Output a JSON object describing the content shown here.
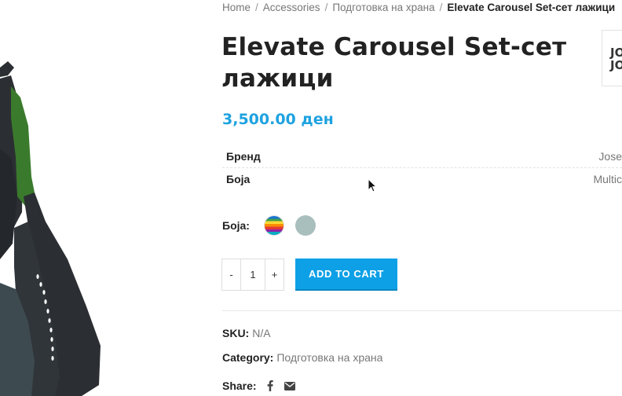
{
  "breadcrumb": {
    "items": [
      "Home",
      "Accessories",
      "Подготовка на храна"
    ],
    "current": "Elevate Carousel Set-сет лажици",
    "separator": "/"
  },
  "product": {
    "title": "Elevate Carousel Set-сет лажици",
    "price": "3,500.00 ден",
    "brand_logo_text": [
      "JO",
      "JO"
    ]
  },
  "attributes": [
    {
      "key": "Бренд",
      "value": "Jose"
    },
    {
      "key": "Боја",
      "value": "Multic"
    }
  ],
  "color_picker": {
    "label": "Боја",
    "label_suffix": ":",
    "options": [
      "multi-color",
      "sage-gray"
    ]
  },
  "quantity": {
    "minus": "-",
    "value": "1",
    "plus": "+"
  },
  "add_to_cart": "ADD TO CART",
  "meta": {
    "sku_label": "SKU:",
    "sku_value": "N/A",
    "category_label": "Category:",
    "category_value": "Подготовка на храна",
    "share_label": "Share:"
  },
  "colors": {
    "accent": "#1ea2e0",
    "button": "#0da0e6",
    "swatch_plain": "#a9bfbd",
    "handle_green": "#3a7a2c",
    "utensil_dark": "#2b2f33"
  },
  "icons": [
    "facebook-icon",
    "envelope-icon"
  ]
}
